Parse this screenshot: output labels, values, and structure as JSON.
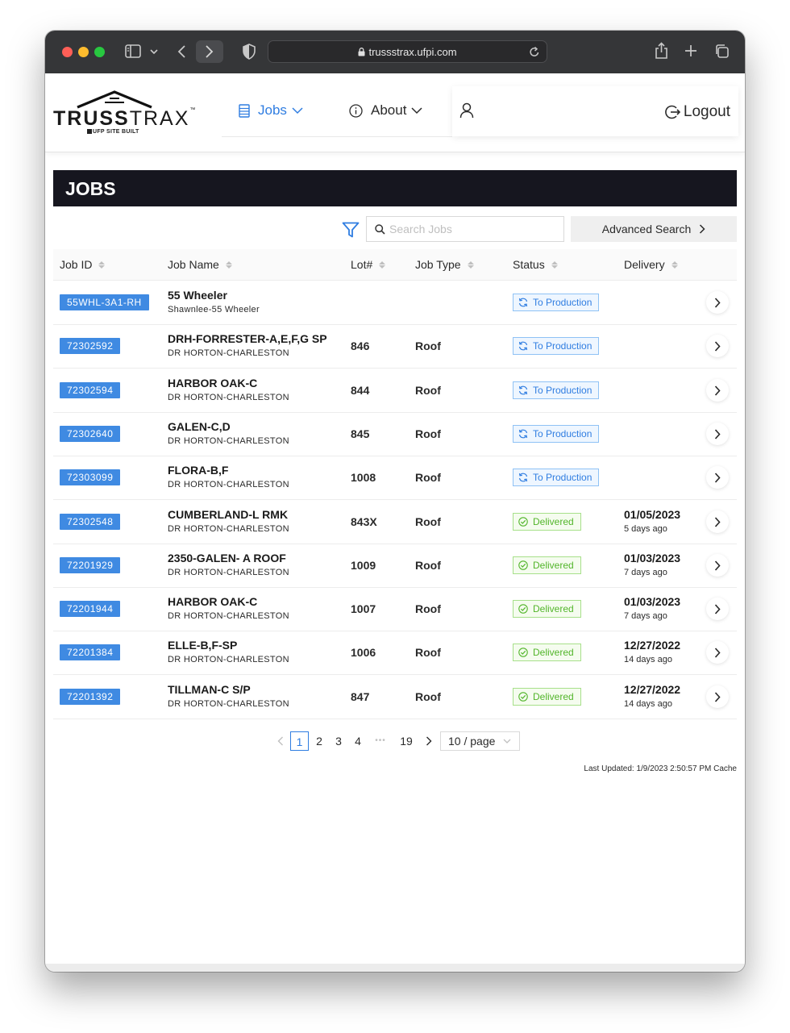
{
  "browser": {
    "url": "trussstrax.ufpi.com"
  },
  "header": {
    "logo_main_bold": "TRUSS",
    "logo_main_light": "TRAX",
    "logo_tm": "™",
    "logo_sub": "UFP SITE BUILT",
    "nav_jobs": "Jobs",
    "nav_about": "About",
    "logout_label": "Logout"
  },
  "colors": {
    "accent": "#2f7de1",
    "banner": "#16161f",
    "delivered": "#52b52a"
  },
  "page": {
    "title": "JOBS"
  },
  "search": {
    "placeholder": "Search Jobs",
    "value": "",
    "advanced_label": "Advanced Search"
  },
  "table": {
    "columns": [
      "Job ID",
      "Job Name",
      "Lot#",
      "Job Type",
      "Status",
      "Delivery"
    ],
    "rows": [
      {
        "id": "55WHL-3A1-RH",
        "name": "55 Wheeler",
        "customer": "Shawnlee-55 Wheeler",
        "lot": "",
        "type": "",
        "status": "To Production",
        "status_kind": "prod",
        "delivery": "",
        "ago": ""
      },
      {
        "id": "72302592",
        "name": "DRH-FORRESTER-A,E,F,G SP",
        "customer": "DR HORTON-CHARLESTON",
        "lot": "846",
        "type": "Roof",
        "status": "To Production",
        "status_kind": "prod",
        "delivery": "",
        "ago": ""
      },
      {
        "id": "72302594",
        "name": "HARBOR OAK-C",
        "customer": "DR HORTON-CHARLESTON",
        "lot": "844",
        "type": "Roof",
        "status": "To Production",
        "status_kind": "prod",
        "delivery": "",
        "ago": ""
      },
      {
        "id": "72302640",
        "name": "GALEN-C,D",
        "customer": "DR HORTON-CHARLESTON",
        "lot": "845",
        "type": "Roof",
        "status": "To Production",
        "status_kind": "prod",
        "delivery": "",
        "ago": ""
      },
      {
        "id": "72303099",
        "name": "FLORA-B,F",
        "customer": "DR HORTON-CHARLESTON",
        "lot": "1008",
        "type": "Roof",
        "status": "To Production",
        "status_kind": "prod",
        "delivery": "",
        "ago": ""
      },
      {
        "id": "72302548",
        "name": "CUMBERLAND-L RMK",
        "customer": "DR HORTON-CHARLESTON",
        "lot": "843X",
        "type": "Roof",
        "status": "Delivered",
        "status_kind": "deliv",
        "delivery": "01/05/2023",
        "ago": "5 days ago"
      },
      {
        "id": "72201929",
        "name": "2350-GALEN- A ROOF",
        "customer": "DR HORTON-CHARLESTON",
        "lot": "1009",
        "type": "Roof",
        "status": "Delivered",
        "status_kind": "deliv",
        "delivery": "01/03/2023",
        "ago": "7 days ago"
      },
      {
        "id": "72201944",
        "name": "HARBOR OAK-C",
        "customer": "DR HORTON-CHARLESTON",
        "lot": "1007",
        "type": "Roof",
        "status": "Delivered",
        "status_kind": "deliv",
        "delivery": "01/03/2023",
        "ago": "7 days ago"
      },
      {
        "id": "72201384",
        "name": "ELLE-B,F-SP",
        "customer": "DR HORTON-CHARLESTON",
        "lot": "1006",
        "type": "Roof",
        "status": "Delivered",
        "status_kind": "deliv",
        "delivery": "12/27/2022",
        "ago": "14 days ago"
      },
      {
        "id": "72201392",
        "name": "TILLMAN-C S/P",
        "customer": "DR HORTON-CHARLESTON",
        "lot": "847",
        "type": "Roof",
        "status": "Delivered",
        "status_kind": "deliv",
        "delivery": "12/27/2022",
        "ago": "14 days ago"
      }
    ]
  },
  "pagination": {
    "pages": [
      "1",
      "2",
      "3",
      "4"
    ],
    "ellipsis": "•••",
    "last_page": "19",
    "current": "1",
    "page_size": "10 / page"
  },
  "footer": {
    "last_updated": "Last Updated: 1/9/2023 2:50:57 PM Cache"
  }
}
